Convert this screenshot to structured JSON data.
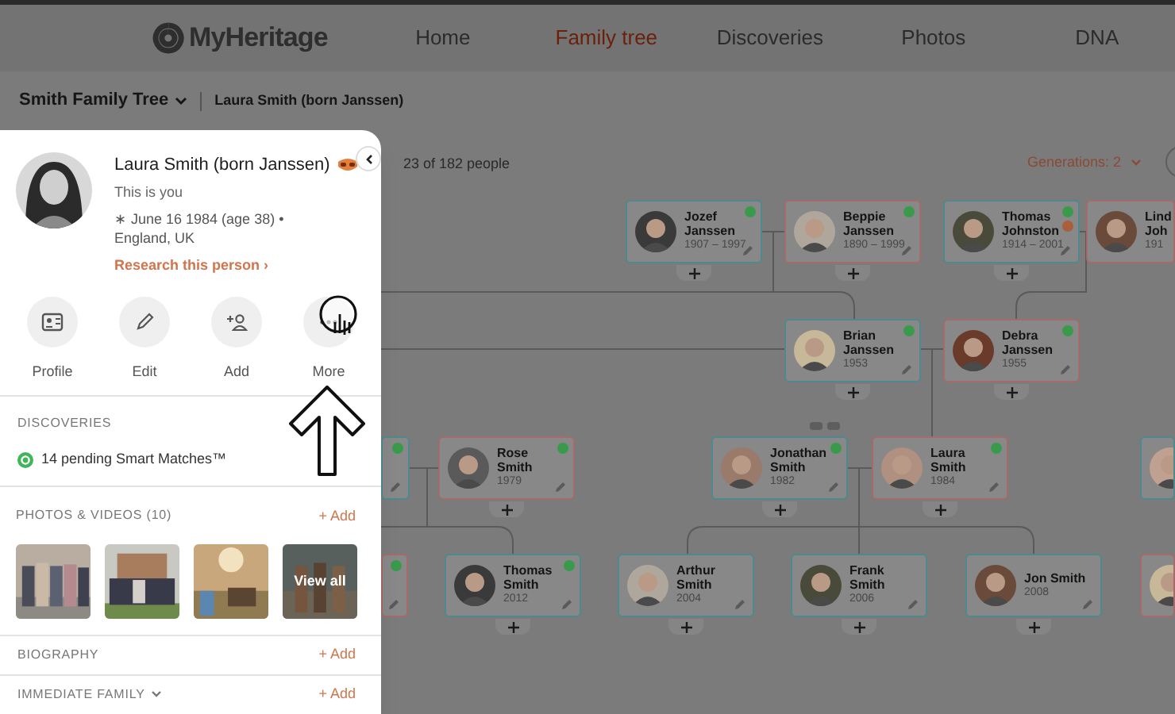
{
  "header": {
    "logo": "MyHeritage",
    "nav": [
      {
        "label": "Home",
        "selected": false
      },
      {
        "label": "Family tree",
        "selected": true
      },
      {
        "label": "Discoveries",
        "selected": false
      },
      {
        "label": "Photos",
        "selected": false
      },
      {
        "label": "DNA",
        "selected": false
      }
    ]
  },
  "breadcrumb": {
    "tree": "Smith Family Tree",
    "person": "Laura Smith (born Janssen)"
  },
  "panel": {
    "name": "Laura Smith (born Janssen)",
    "subtitle": "This is you",
    "birth": "∗ June 16 1984 (age 38) • England, UK",
    "research_link": "Research this person ›",
    "actions": [
      {
        "label": "Profile",
        "kind": "profile"
      },
      {
        "label": "Edit",
        "kind": "edit"
      },
      {
        "label": "Add",
        "kind": "add"
      },
      {
        "label": "More",
        "kind": "more"
      }
    ],
    "discoveries": {
      "heading": "DISCOVERIES",
      "item": "14 pending Smart Matches™"
    },
    "photos": {
      "heading": "PHOTOS & VIDEOS (10)",
      "add": "+ Add",
      "thumbnails": [
        {
          "kind": "picture"
        },
        {
          "kind": "picture"
        },
        {
          "kind": "picture"
        },
        {
          "kind": "picture",
          "overlay": "View all"
        }
      ]
    },
    "biography": {
      "heading": "BIOGRAPHY",
      "add": "+ Add"
    },
    "immediate_family": {
      "heading": "IMMEDIATE FAMILY",
      "add": "+ Add"
    }
  },
  "tree": {
    "count": "23 of 182 people",
    "generations": "Generations: 2",
    "people": [
      {
        "kind": "person",
        "name": "Jozef Janssen",
        "dates": "1907 – 1997",
        "color": "#4e8a8d",
        "smart_match": true,
        "record_match": false
      },
      {
        "kind": "person",
        "name": "Beppie Janssen",
        "dates": "1890 – 1999",
        "color": "#a56a6a",
        "smart_match": true,
        "record_match": false
      },
      {
        "kind": "person",
        "name": "Thomas Johnston",
        "dates": "1914 – 2001",
        "color": "#4e8a8d",
        "smart_match": true,
        "record_match": true
      },
      {
        "kind": "person",
        "name": "Lind Joh",
        "dates": "191",
        "color": "#a56a6a"
      },
      {
        "kind": "person",
        "name": "Brian Janssen",
        "dates": "1953",
        "color": "#4e8a8d",
        "smart_match": true,
        "record_match": false
      },
      {
        "kind": "person",
        "name": "Debra Janssen",
        "dates": "1955",
        "color": "#a56a6a",
        "smart_match": true,
        "record_match": false
      },
      {
        "kind": "partial",
        "color": "#4e8a8d",
        "smart_match": true,
        "record_match": false
      },
      {
        "kind": "person",
        "name": "Rose Smith",
        "dates": "1979",
        "color": "#a56a6a",
        "smart_match": true,
        "record_match": false
      },
      {
        "kind": "person",
        "name": "Jonathan Smith",
        "dates": "1982",
        "color": "#4e8a8d",
        "smart_match": true,
        "record_match": false
      },
      {
        "kind": "person",
        "name": "Laura Smith",
        "dates": "1984",
        "color": "#a56a6a",
        "smart_match": true,
        "record_match": false
      },
      {
        "kind": "partial",
        "color": "#4e8a8d"
      },
      {
        "kind": "partial",
        "color": "#a56a6a",
        "smart_match": true,
        "record_match": false
      },
      {
        "kind": "person",
        "name": "Thomas Smith",
        "dates": "2012",
        "color": "#4e8a8d",
        "smart_match": true,
        "record_match": false
      },
      {
        "kind": "person",
        "name": "Arthur Smith",
        "dates": "2004",
        "color": "#4e8a8d",
        "smart_match": false,
        "record_match": false
      },
      {
        "kind": "person",
        "name": "Frank Smith",
        "dates": "2006",
        "color": "#4e8a8d",
        "smart_match": false,
        "record_match": false
      },
      {
        "kind": "person",
        "name": "Jon Smith",
        "dates": "2008",
        "color": "#4e8a8d",
        "smart_match": false,
        "record_match": false
      },
      {
        "kind": "partial",
        "color": "#a56a6a"
      }
    ]
  }
}
